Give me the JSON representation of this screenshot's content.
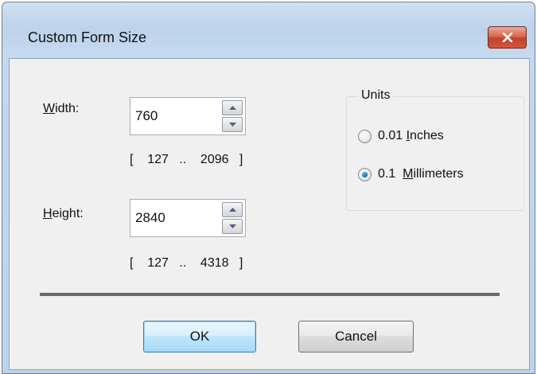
{
  "window": {
    "title": "Custom Form Size"
  },
  "width": {
    "label_prefix": "",
    "label_accel": "W",
    "label_rest": "idth:",
    "value": "760",
    "range": "[    127   ..    2096   ]"
  },
  "height": {
    "label_accel": "H",
    "label_rest": "eight:",
    "value": "2840",
    "range": "[    127   ..    4318   ]"
  },
  "units": {
    "title": "Units",
    "options": [
      {
        "prefix": "0.01 ",
        "accel": "I",
        "rest": "nches",
        "checked": false
      },
      {
        "prefix": "0.1  ",
        "accel": "M",
        "rest": "illimeters",
        "checked": true
      }
    ]
  },
  "buttons": {
    "ok": "OK",
    "cancel": "Cancel"
  },
  "colors": {
    "close_button": "#c3412a",
    "default_button_border": "#3c7fb1",
    "radio_dot": "#1e62b8"
  }
}
